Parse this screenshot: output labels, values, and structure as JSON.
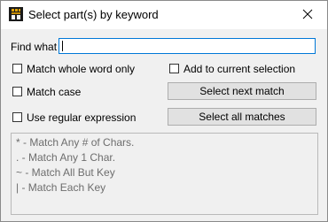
{
  "window": {
    "title": "Select part(s) by keyword",
    "app_icon": "app-logo-icon",
    "close_icon": "close-icon"
  },
  "find": {
    "label": "Find what",
    "value": ""
  },
  "options": {
    "match_whole_word": {
      "label": "Match whole word only",
      "checked": false
    },
    "add_to_selection": {
      "label": "Add to current selection",
      "checked": false
    },
    "match_case": {
      "label": "Match case",
      "checked": false
    },
    "regex": {
      "label": "Use regular expression",
      "checked": false
    }
  },
  "buttons": {
    "select_next": "Select next match",
    "select_all": "Select all matches"
  },
  "hints": [
    "* - Match Any # of Chars.",
    ". - Match Any 1 Char.",
    "~ - Match All But Key",
    "| - Match Each Key"
  ],
  "colors": {
    "focus_border": "#0078d7",
    "hint_text": "#6d6d6d",
    "button_face": "#e1e1e1"
  }
}
